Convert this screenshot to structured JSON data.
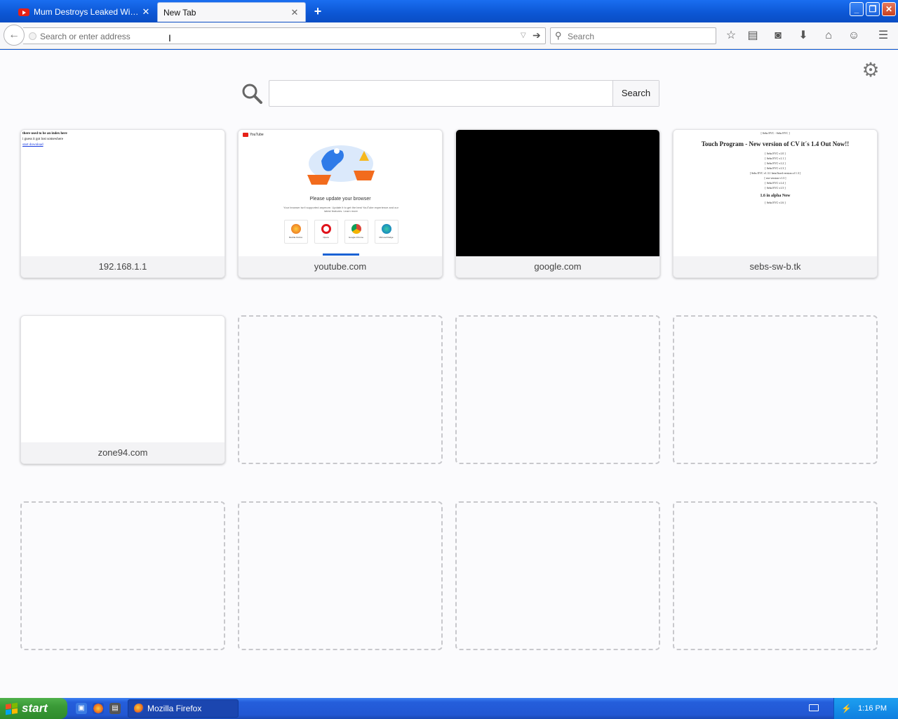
{
  "tabs": [
    {
      "label": "Mum Destroys Leaked Windo...",
      "icon": "youtube-icon",
      "active": false
    },
    {
      "label": "New Tab",
      "active": true
    }
  ],
  "toolbar": {
    "url_placeholder": "Search or enter address",
    "search_placeholder": "Search",
    "icons": [
      "back-arrow-icon",
      "go-arrow-icon",
      "bookmark-star-icon",
      "reading-list-icon",
      "pocket-icon",
      "download-icon",
      "home-icon",
      "chat-icon",
      "menu-icon"
    ]
  },
  "newtab": {
    "search_button": "Search",
    "tiles": [
      {
        "caption": "192.168.1.1"
      },
      {
        "caption": "youtube.com"
      },
      {
        "caption": "google.com"
      },
      {
        "caption": "sebs-sw-b.tk"
      },
      {
        "caption": "zone94.com"
      }
    ],
    "thumb_router": {
      "line1": "there used to be an index here",
      "line2": "i guess it got lost somewhere",
      "link": "start download"
    },
    "thumb_youtube": {
      "logo": "YouTube",
      "title": "Please update your browser",
      "text": "Your browser isn't supported anymore. Update it to get the best YouTube experience and our latest features. Learn more",
      "browsers": [
        "Mozilla Firefox",
        "Opera",
        "Google Chrome",
        "Microsoft Edge"
      ]
    },
    "thumb_sebs": {
      "top": "[ Sebs EVC - Sebs EVC ]",
      "headline": "Touch Program - New version of CV it´s 1.4 Out Now!!",
      "versions": [
        "[ Sebs EVC v1.0 ]",
        "[ Sebs EVC v1.1 ]",
        "[ Sebs EVC v1.2 ]",
        "[ Sebs EVC v1.3 ]",
        "[ Sebs EVC v1.3.1 beta/fixed version of 1.3 ]",
        "[ exe version v1.3 ]",
        "[ Sebs EVC v1.4 ]",
        "[ Sebs EVC v1.5 ]"
      ],
      "mid": "1.6 in alpha Now",
      "bottom": "[ Sebs EVC v1.6 ]"
    }
  },
  "taskbar": {
    "start_label": "start",
    "task_label": "Mozilla Firefox",
    "clock": "1:16 PM"
  },
  "colors": {
    "titlebar": "#0c56d4",
    "taskbar": "#245edb",
    "start": "#3a9a37",
    "tray": "#0f7fe0",
    "youtube_red": "#e62117"
  }
}
